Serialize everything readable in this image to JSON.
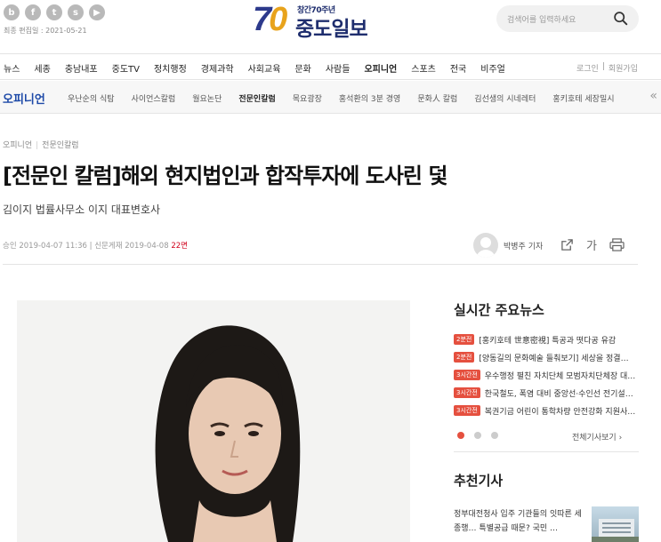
{
  "header": {
    "social_icons": [
      "naver-blog-icon",
      "facebook-icon",
      "twitter-icon",
      "kakao-story-icon",
      "youtube-icon"
    ],
    "updated": "최종 편집일 : 2021-05-21",
    "logo": {
      "number": "70",
      "small_text": "창간70주년",
      "name": "중도일보"
    },
    "search_placeholder": "검색어를 입력하세요"
  },
  "main_nav": {
    "items": [
      "뉴스",
      "세종",
      "충남내포",
      "중도TV",
      "정치행정",
      "경제과학",
      "사회교육",
      "문화",
      "사람들",
      "오피니언",
      "스포츠",
      "전국",
      "비주얼"
    ],
    "active": "오피니언",
    "login": "로그인",
    "join": "회원가입"
  },
  "sub_nav": {
    "title": "오피니언",
    "items": [
      "우난순의 식탐",
      "사이언스칼럼",
      "월요논단",
      "전문인칼럼",
      "목요광장",
      "홍석환의 3분 경영",
      "문화人 칼럼",
      "김선생의 시네레터",
      "홍키호테 세장밀시"
    ],
    "active": "전문인칼럼"
  },
  "article": {
    "breadcrumb": [
      "오피니언",
      "전문인칼럼"
    ],
    "title": "[전문인 칼럼]해외 현지법인과 합작투자에 도사린 덫",
    "subtitle": "김이지 법률사무소 이지 대표변호사",
    "approved": "승인 2019-04-07 11:36",
    "published": "신문게재 2019-04-08",
    "page": "22면",
    "reporter": "박병주 기자",
    "font_tool": "가"
  },
  "sidebar": {
    "realtime_title": "실시간 주요뉴스",
    "news": [
      {
        "badge": "2분전",
        "text": "[홍키호테 世意密視] 특공과 떳다공 유감"
      },
      {
        "badge": "2분전",
        "text": "[양동길의 문화예술 들춰보기] 세상을 정결…"
      },
      {
        "badge": "3시간전",
        "text": "우수행정 펼친 자치단체 모범자치단체장 대…"
      },
      {
        "badge": "3시간전",
        "text": "한국철도, 폭염 대비 중앙선·수인선 전기설…"
      },
      {
        "badge": "3시간전",
        "text": "복권기금 어린이 통학차량 안전강화 지원사…"
      }
    ],
    "all_news": "전체기사보기",
    "recommend_title": "추천기사",
    "recommend_text": "정부대전청사 입주 기관들의 잇따른 세종행… 특별공급 때문? 국민 …"
  },
  "colors": {
    "accent_blue": "#1e4aa8",
    "badge_red": "#e5503f",
    "page_red": "#d0021b"
  }
}
